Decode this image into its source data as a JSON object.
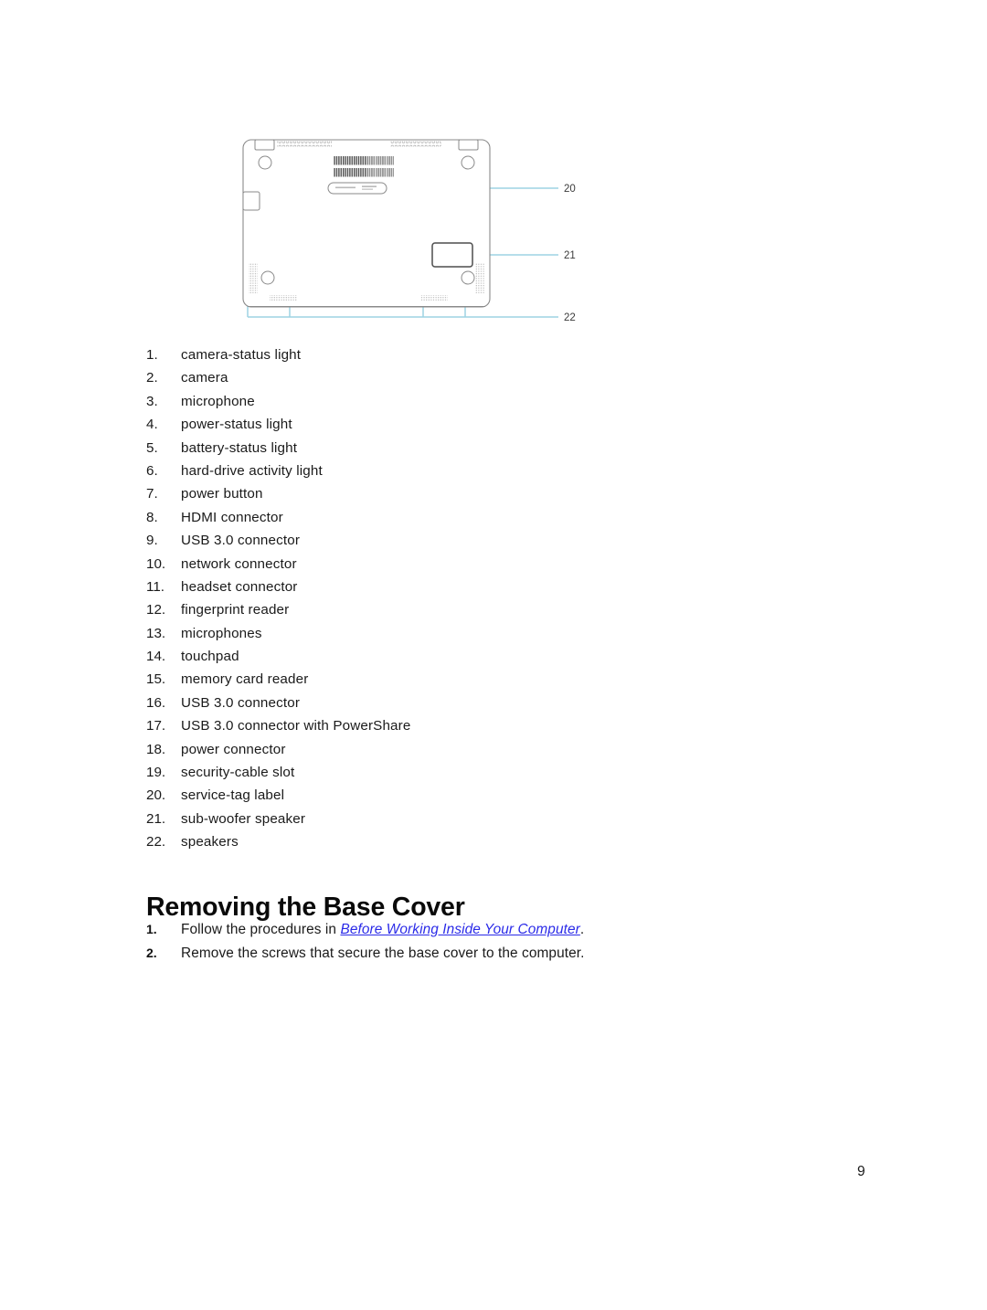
{
  "figure": {
    "name": "laptop-base-bottom-view-diagram",
    "line_color": "#8a8a8a",
    "leader_color": "#9ed3e3",
    "callout_text_color": "#3a3a3a",
    "callouts": [
      {
        "id": "20",
        "label": "20",
        "target": "service-tag-label"
      },
      {
        "id": "21",
        "label": "21",
        "target": "sub-woofer-speaker"
      },
      {
        "id": "22",
        "label": "22",
        "target": "speakers"
      }
    ]
  },
  "callout_list": {
    "items": [
      {
        "num": "1.",
        "text": "camera-status light"
      },
      {
        "num": "2.",
        "text": "camera"
      },
      {
        "num": "3.",
        "text": "microphone"
      },
      {
        "num": "4.",
        "text": "power-status light"
      },
      {
        "num": "5.",
        "text": "battery-status light"
      },
      {
        "num": "6.",
        "text": "hard-drive activity light"
      },
      {
        "num": "7.",
        "text": "power button"
      },
      {
        "num": "8.",
        "text": "HDMI connector"
      },
      {
        "num": "9.",
        "text": "USB 3.0 connector"
      },
      {
        "num": "10.",
        "text": "network connector"
      },
      {
        "num": "11.",
        "text": "headset connector"
      },
      {
        "num": "12.",
        "text": "fingerprint reader"
      },
      {
        "num": "13.",
        "text": "microphones"
      },
      {
        "num": "14.",
        "text": "touchpad"
      },
      {
        "num": "15.",
        "text": "memory card reader"
      },
      {
        "num": "16.",
        "text": "USB 3.0 connector"
      },
      {
        "num": "17.",
        "text": "USB 3.0 connector with PowerShare"
      },
      {
        "num": "18.",
        "text": "power connector"
      },
      {
        "num": "19.",
        "text": "security-cable slot"
      },
      {
        "num": "20.",
        "text": "service-tag label"
      },
      {
        "num": "21.",
        "text": "sub-woofer speaker"
      },
      {
        "num": "22.",
        "text": "speakers"
      }
    ]
  },
  "section": {
    "heading": "Removing the Base Cover"
  },
  "procedure": {
    "steps": [
      {
        "num": "1.",
        "before_link": "Follow the procedures in ",
        "link": "Before Working Inside Your Computer",
        "after_link": "."
      },
      {
        "num": "2.",
        "before_link": "Remove the screws that secure the base cover to the computer.",
        "link": "",
        "after_link": ""
      }
    ]
  },
  "footer": {
    "page_number": "9"
  }
}
